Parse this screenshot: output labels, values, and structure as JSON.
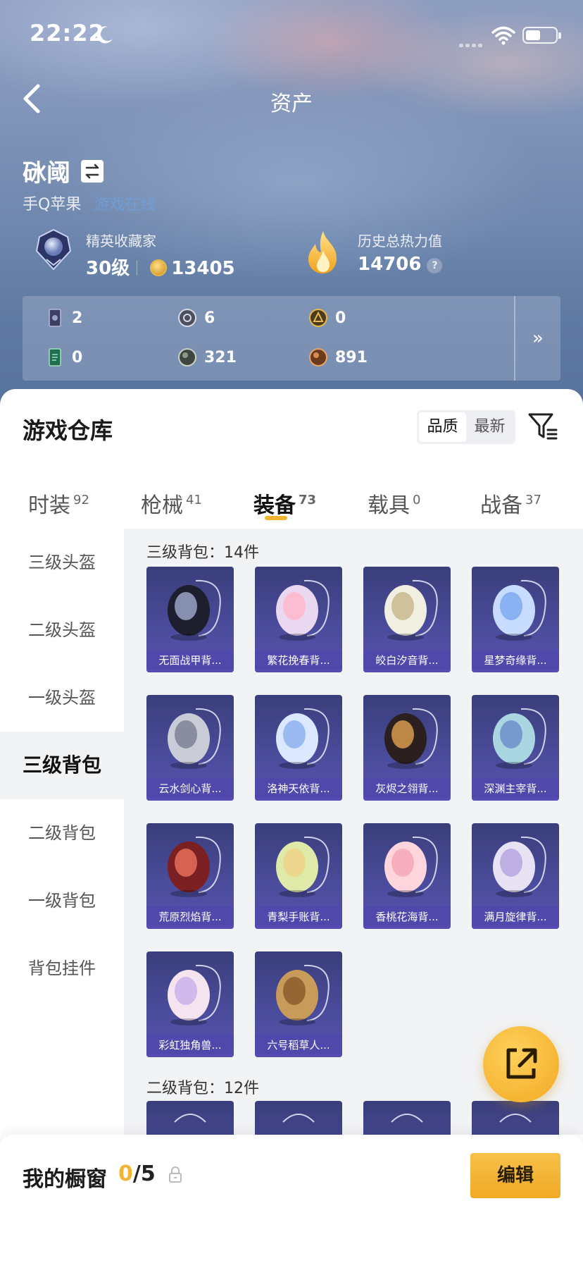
{
  "status_bar": {
    "time": "22:22"
  },
  "nav": {
    "title": "资产"
  },
  "profile": {
    "name": "砯阈",
    "platform": "手Q苹果",
    "platform_link": "游戏在线"
  },
  "stats": {
    "rank_label": "精英收藏家",
    "rank_level": "30级",
    "rank_points": "13405",
    "heat_label": "历史总热力值",
    "heat_value": "14706",
    "help_glyph": "?"
  },
  "currencies": [
    {
      "icon": "card-icon",
      "value": "2"
    },
    {
      "icon": "silver-coin-icon",
      "value": "6"
    },
    {
      "icon": "gold-coin-icon",
      "value": "0"
    },
    {
      "icon": "green-card-icon",
      "value": "0"
    },
    {
      "icon": "dark-orb-icon",
      "value": "321"
    },
    {
      "icon": "bronze-orb-icon",
      "value": "891"
    }
  ],
  "more_glyph": "»",
  "warehouse": {
    "title": "游戏仓库",
    "sort_options": [
      "品质",
      "最新"
    ],
    "tabs": [
      {
        "label": "时装",
        "count": "92"
      },
      {
        "label": "枪械",
        "count": "41"
      },
      {
        "label": "装备",
        "count": "73"
      },
      {
        "label": "载具",
        "count": "0"
      },
      {
        "label": "战备",
        "count": "37"
      }
    ],
    "sidebar": [
      "三级头盔",
      "二级头盔",
      "一级头盔",
      "三级背包",
      "二级背包",
      "一级背包",
      "背包挂件"
    ]
  },
  "sections": [
    {
      "title": "三级背包：14件",
      "items": [
        "无面战甲背...",
        "繁花挽春背...",
        "皎白汐音背...",
        "星梦奇缘背...",
        "云水剑心背...",
        "洛神天依背...",
        "灰烬之翎背...",
        "深渊主宰背...",
        "荒原烈焰背...",
        "青梨手账背...",
        "香桃花海背...",
        "满月旋律背...",
        "彩虹独角兽...",
        "六号稻草人..."
      ]
    },
    {
      "title": "二级背包：12件"
    }
  ],
  "bottom": {
    "title": "我的橱窗",
    "count_current": "0",
    "count_total": "/5",
    "edit_label": "编辑"
  },
  "colors": {
    "accent": "#f3b531",
    "card": "#4a4b9a"
  }
}
